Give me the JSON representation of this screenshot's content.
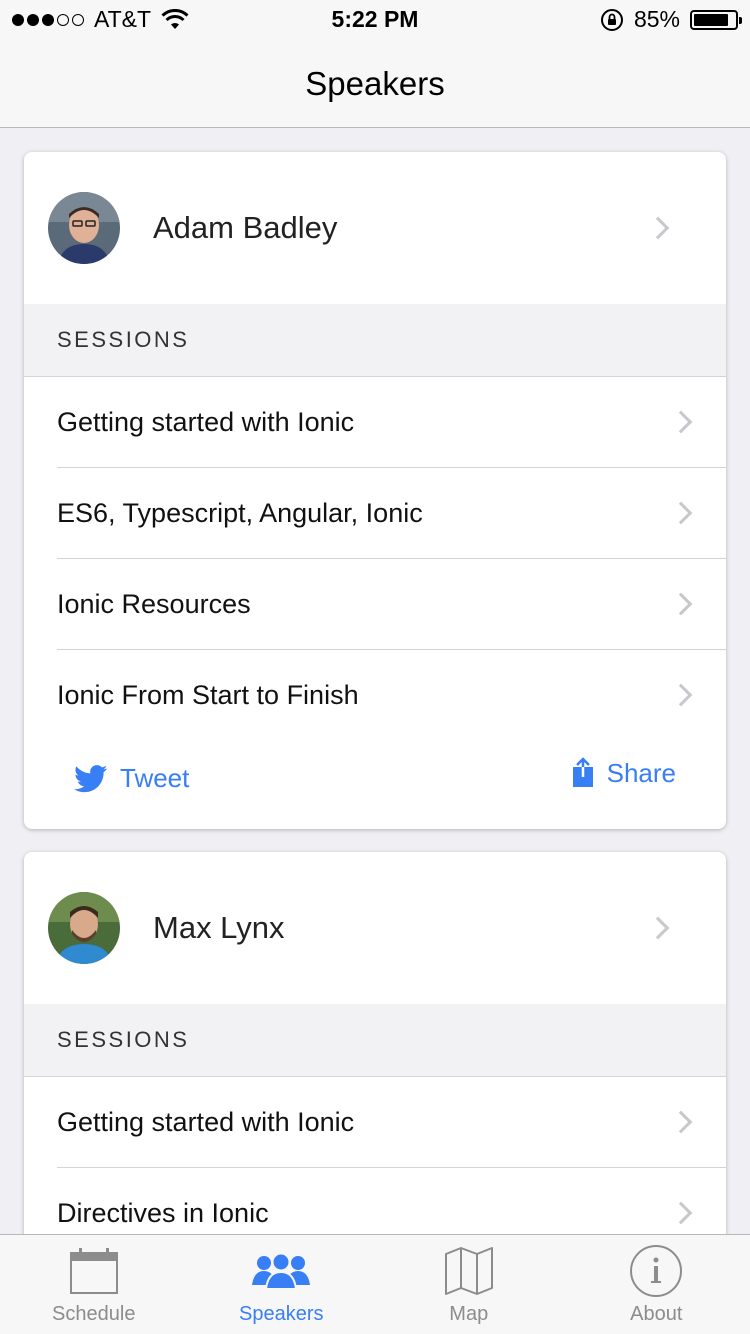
{
  "status_bar": {
    "carrier": "AT&T",
    "time": "5:22 PM",
    "battery": "85%",
    "battery_level": 0.85
  },
  "navbar": {
    "title": "Speakers"
  },
  "speakers": [
    {
      "name": "Adam Badley",
      "sessions_label": "SESSIONS",
      "sessions": [
        "Getting started with Ionic",
        "ES6, Typescript, Angular, Ionic",
        "Ionic Resources",
        "Ionic From Start to Finish"
      ],
      "tweet_label": "Tweet",
      "share_label": "Share"
    },
    {
      "name": "Max Lynx",
      "sessions_label": "SESSIONS",
      "sessions": [
        "Getting started with Ionic",
        "Directives in Ionic"
      ]
    }
  ],
  "tabs": [
    {
      "label": "Schedule",
      "icon": "calendar-icon",
      "active": false
    },
    {
      "label": "Speakers",
      "icon": "people-icon",
      "active": true
    },
    {
      "label": "Map",
      "icon": "map-icon",
      "active": false
    },
    {
      "label": "About",
      "icon": "info-icon",
      "active": false
    }
  ],
  "colors": {
    "accent": "#387ef5",
    "inactive": "#8c8c8c",
    "background": "#efeff4"
  }
}
